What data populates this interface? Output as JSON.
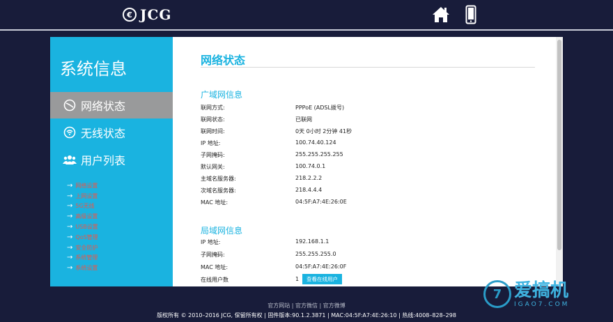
{
  "header": {
    "brand": "JCG",
    "logo_mark": "€"
  },
  "sidebar": {
    "title": "系统信息",
    "nav": [
      {
        "label": "网络状态",
        "icon": "network-status-icon",
        "active": true
      },
      {
        "label": "无线状态",
        "icon": "wifi-icon",
        "active": false
      },
      {
        "label": "用户列表",
        "icon": "users-icon",
        "active": false
      }
    ],
    "sublinks": [
      "网络设置",
      "上网设置",
      "5G无线",
      "高级设置",
      "USB设置",
      "QoS管理",
      "安全防护",
      "系统管理",
      "系统设置"
    ]
  },
  "main": {
    "title": "网络状态",
    "wan": {
      "title": "广域网信息",
      "rows": [
        {
          "key": "联网方式:",
          "value": "PPPoE (ADSL拨号)"
        },
        {
          "key": "联网状态:",
          "value": "已联网"
        },
        {
          "key": "联网时间:",
          "value": "0天 0小时 2分钟 41秒"
        },
        {
          "key": "IP 地址:",
          "value": "100.74.40.124"
        },
        {
          "key": "子网掩码:",
          "value": "255.255.255.255"
        },
        {
          "key": "默认网关:",
          "value": "100.74.0.1"
        },
        {
          "key": "主域名服务器:",
          "value": "218.2.2.2"
        },
        {
          "key": "次域名服务器:",
          "value": "218.4.4.4"
        },
        {
          "key": "MAC 地址:",
          "value": "04:5F:A7:4E:26:0E"
        }
      ]
    },
    "lan": {
      "title": "局域网信息",
      "rows": [
        {
          "key": "IP 地址:",
          "value": "192.168.1.1"
        },
        {
          "key": "子网掩码:",
          "value": "255.255.255.0"
        },
        {
          "key": "MAC 地址:",
          "value": "04:5F:A7:4E:26:0F"
        },
        {
          "key": "在线用户数",
          "value": "1"
        }
      ],
      "online_button": "查看在线用户"
    }
  },
  "footer": {
    "links": [
      "官方网站",
      "官方微信",
      "官方微博"
    ],
    "separator": "|",
    "copyright": "版权所有 © 2010–2016 JCG, 保留所有权  |  固件版本:90.1.2.3871  |  MAC:04:5F:A7:4E:26:10  |  热线:4008–828–298"
  },
  "watermark": {
    "mark": "7",
    "cn": "爱搞机",
    "en": "IGAO7.COM"
  },
  "colors": {
    "background": "#181c3a",
    "accent": "#1ab3e0",
    "active_nav": "#999a9b",
    "sublink": "#e8574a"
  }
}
